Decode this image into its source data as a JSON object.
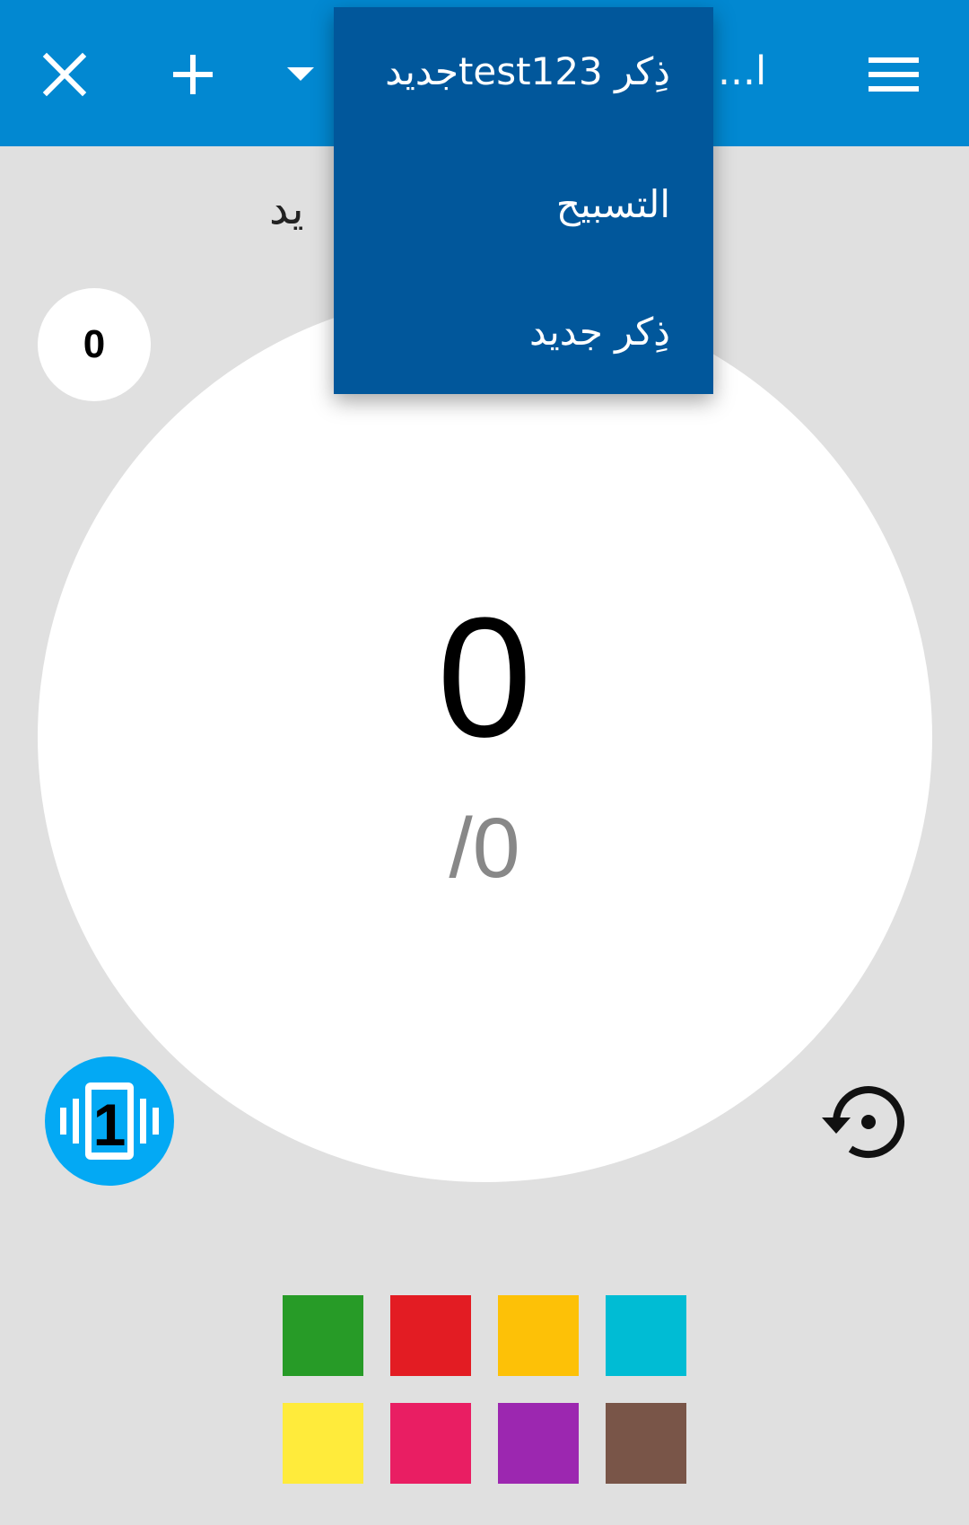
{
  "appbar": {
    "title": "ا...",
    "close_icon": "close-icon",
    "add_icon": "plus-icon",
    "dropdown_icon": "caret-down-icon",
    "menu_icon": "menu-icon",
    "background": "#0288d1"
  },
  "subtitle": "يد",
  "dropdown": {
    "items": [
      {
        "label": "ذِكر test123جديد"
      },
      {
        "label": "التسبيح"
      },
      {
        "label": "ذِكر جديد"
      }
    ],
    "background": "#01579b"
  },
  "counter": {
    "badge_value": "0",
    "count": "0",
    "target": "/0"
  },
  "controls": {
    "vibrate_icon": "vibrate-one-icon",
    "vibrate_color": "#03a9f4",
    "reset_icon": "reset-history-icon"
  },
  "swatches": [
    {
      "name": "green",
      "color": "#279b27"
    },
    {
      "name": "red",
      "color": "#e31c23"
    },
    {
      "name": "amber",
      "color": "#fdc107"
    },
    {
      "name": "cyan",
      "color": "#00bcd4"
    },
    {
      "name": "yellow",
      "color": "#ffeb3b"
    },
    {
      "name": "pink",
      "color": "#e91e63"
    },
    {
      "name": "purple",
      "color": "#9c27b0"
    },
    {
      "name": "brown",
      "color": "#795548"
    }
  ]
}
